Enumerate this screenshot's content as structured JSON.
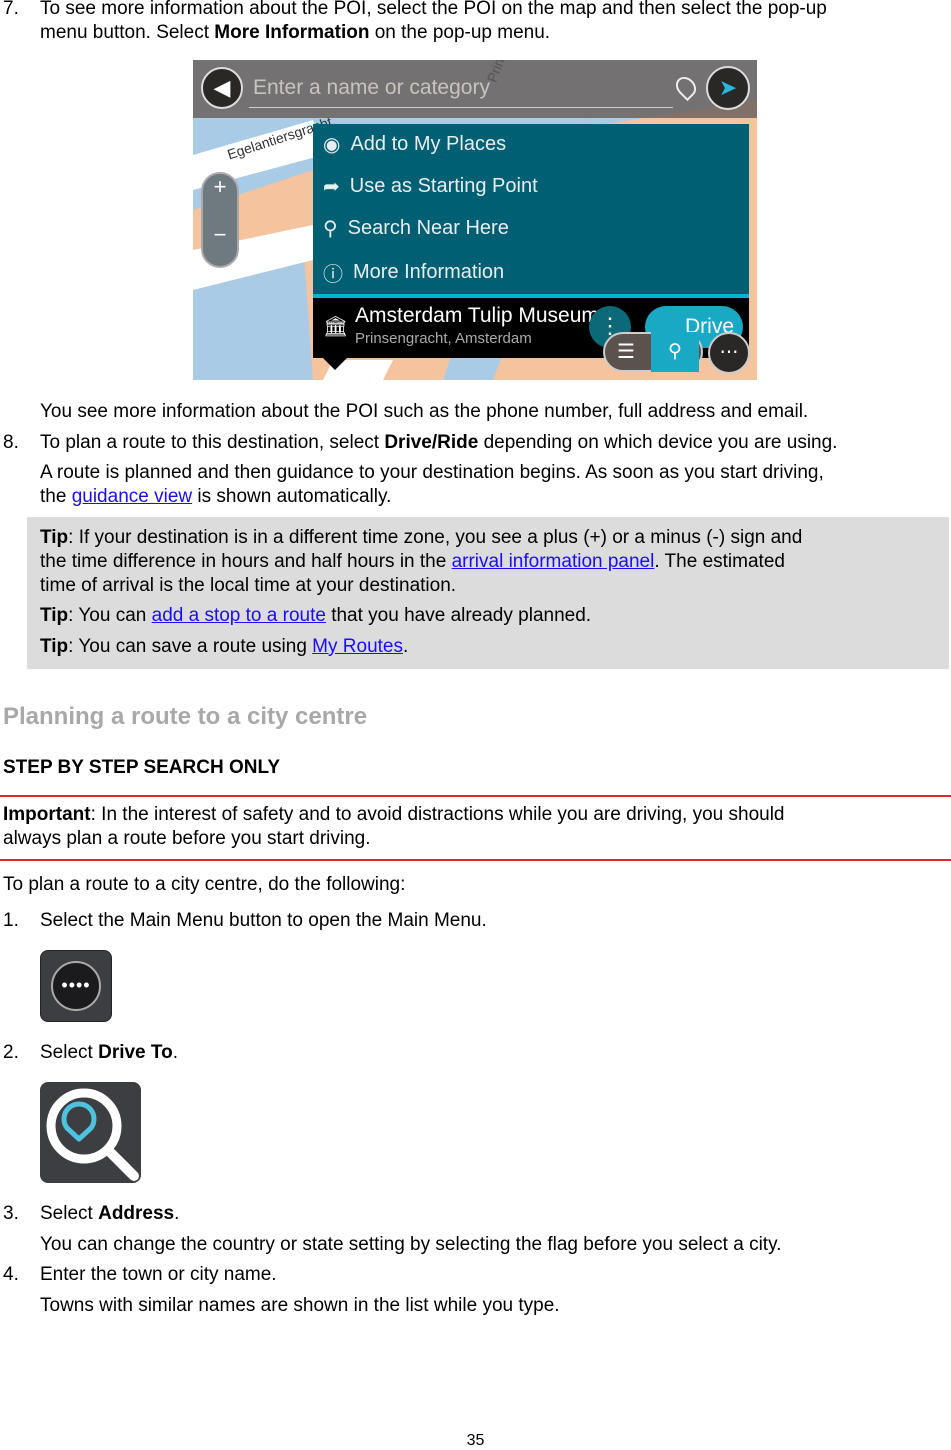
{
  "step7": {
    "num": "7.",
    "l1": "To see more information about the POI, select the POI on the map and then select the pop-up",
    "l2a": "menu button. Select ",
    "l2b": "More Information",
    "l2c": " on the pop-up menu."
  },
  "map": {
    "search_placeholder": "Enter a name or category",
    "street1": "Egelantiersgracht",
    "street2": "Prin",
    "menu": [
      "Add to My Places",
      "Use as Starting Point",
      "Search Near Here",
      "More Information"
    ],
    "poi_name": "Amsterdam Tulip Museum",
    "poi_address": "Prinsengracht, Amsterdam",
    "drive_label": "Drive",
    "colors": {
      "menu_bg": "#005f73",
      "accent": "#00b4d8",
      "poi_bg": "#000000"
    }
  },
  "after7": "You see more information about the POI such as the phone number, full address and email.",
  "step8": {
    "num": "8.",
    "a": "To plan a route to this destination, select ",
    "b": "Drive/Ride",
    "c": " depending on which device you are using.",
    "p1": "A route is planned and then guidance to your destination begins. As soon as you start driving,",
    "p2a": "the ",
    "p2link": "guidance view",
    "p2c": " is shown automatically."
  },
  "tips": {
    "label": "Tip",
    "t1a": ": If your destination is in a different time zone, you see a plus (+) or a minus (-) sign and",
    "t1b": "the time difference in hours and half hours in the ",
    "t1link": "arrival information panel",
    "t1c": ". The estimated",
    "t1d": "time of arrival is the local time at your destination.",
    "t2a": ": You can ",
    "t2link": "add a stop to a route",
    "t2c": " that you have already planned.",
    "t3a": ": You can save a route using ",
    "t3link": "My Routes",
    "t3c": "."
  },
  "heading": "Planning a route to a city centre",
  "subheading": "STEP BY STEP SEARCH ONLY",
  "important": {
    "label": "Important",
    "a": ": In the interest of safety and to avoid distractions while you are driving, you should",
    "b": "always plan a route before you start driving."
  },
  "intro": "To plan a route to a city centre, do the following:",
  "steps": [
    {
      "num": "1.",
      "text": "Select the Main Menu button to open the Main Menu."
    },
    {
      "num": "2.",
      "a": "Select ",
      "b": "Drive To",
      "c": "."
    },
    {
      "num": "3.",
      "a": "Select ",
      "b": "Address",
      "c": ".",
      "sub": "You can change the country or state setting by selecting the flag before you select a city."
    },
    {
      "num": "4.",
      "text": "Enter the town or city name.",
      "sub": "Towns with similar names are shown in the list while you type."
    }
  ],
  "icons": {
    "main_menu": "main-menu-icon",
    "drive_to": "drive-to-search-icon",
    "accent": "#4ec3e0"
  },
  "page_number": "35"
}
